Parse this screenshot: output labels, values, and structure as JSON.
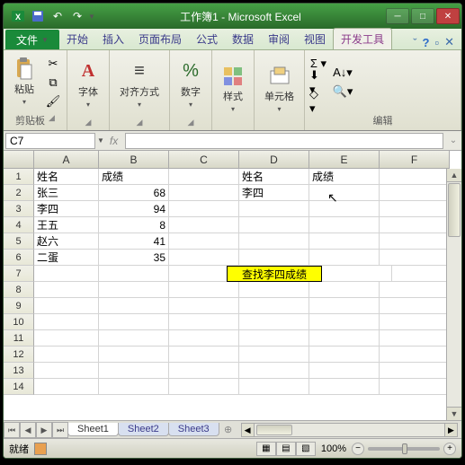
{
  "title": "工作簿1 - Microsoft Excel",
  "tabs": {
    "file": "文件",
    "items": [
      "开始",
      "插入",
      "页面布局",
      "公式",
      "数据",
      "审阅",
      "视图",
      "开发工具"
    ],
    "active": "开发工具"
  },
  "ribbon": {
    "clipboard": {
      "paste": "粘贴",
      "label": "剪贴板"
    },
    "font": {
      "label": "字体"
    },
    "align": {
      "label": "对齐方式"
    },
    "number": {
      "label": "数字"
    },
    "styles": {
      "label": "样式"
    },
    "cells": {
      "label": "单元格"
    },
    "editing": {
      "label": "编辑"
    }
  },
  "namebox": "C7",
  "fx": "fx",
  "columns": [
    "A",
    "B",
    "C",
    "D",
    "E",
    "F"
  ],
  "rows": [
    "1",
    "2",
    "3",
    "4",
    "5",
    "6",
    "7",
    "8",
    "9",
    "10",
    "11",
    "12",
    "13",
    "14"
  ],
  "chart_data": {
    "type": "table",
    "headers_ab": {
      "A": "姓名",
      "B": "成绩"
    },
    "data_ab": [
      {
        "name": "张三",
        "score": 68
      },
      {
        "name": "李四",
        "score": 94
      },
      {
        "name": "王五",
        "score": 8
      },
      {
        "name": "赵六",
        "score": 41
      },
      {
        "name": "二蛋",
        "score": 35
      }
    ],
    "headers_de": {
      "D": "姓名",
      "E": "成绩"
    },
    "lookup_de": {
      "D": "李四",
      "E": ""
    },
    "button_label": "查找李四成绩"
  },
  "sheets": {
    "items": [
      "Sheet1",
      "Sheet2",
      "Sheet3"
    ],
    "active": "Sheet1"
  },
  "status": {
    "ready": "就绪",
    "zoom": "100%"
  }
}
